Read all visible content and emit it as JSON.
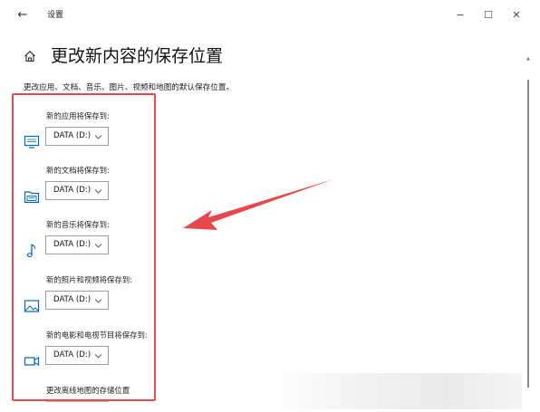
{
  "window": {
    "title": "设置",
    "back_glyph": "←",
    "minimize_glyph": "−",
    "maximize_glyph": "☐",
    "close_glyph": "✕"
  },
  "page": {
    "title": "更改新内容的保存位置",
    "description": "更改应用、文档、音乐、图片、视频和地图的默认保存位置。"
  },
  "settings": [
    {
      "label": "新的应用将保存到:",
      "value": "DATA (D:)",
      "icon": "monitor-icon"
    },
    {
      "label": "新的文档将保存到:",
      "value": "DATA (D:)",
      "icon": "document-folder-icon"
    },
    {
      "label": "新的音乐将保存到:",
      "value": "DATA (D:)",
      "icon": "music-note-icon"
    },
    {
      "label": "新的照片和视频将保存到:",
      "value": "DATA (D:)",
      "icon": "photo-icon"
    },
    {
      "label": "新的电影和电视节目将保存到:",
      "value": "DATA (D:)",
      "icon": "video-camera-icon"
    },
    {
      "label": "更改离线地图的存储位置",
      "value": "",
      "icon": ""
    }
  ],
  "colors": {
    "accent_icon": "#0067c0",
    "highlight": "#e8474b",
    "arrow": "#e8474b"
  }
}
